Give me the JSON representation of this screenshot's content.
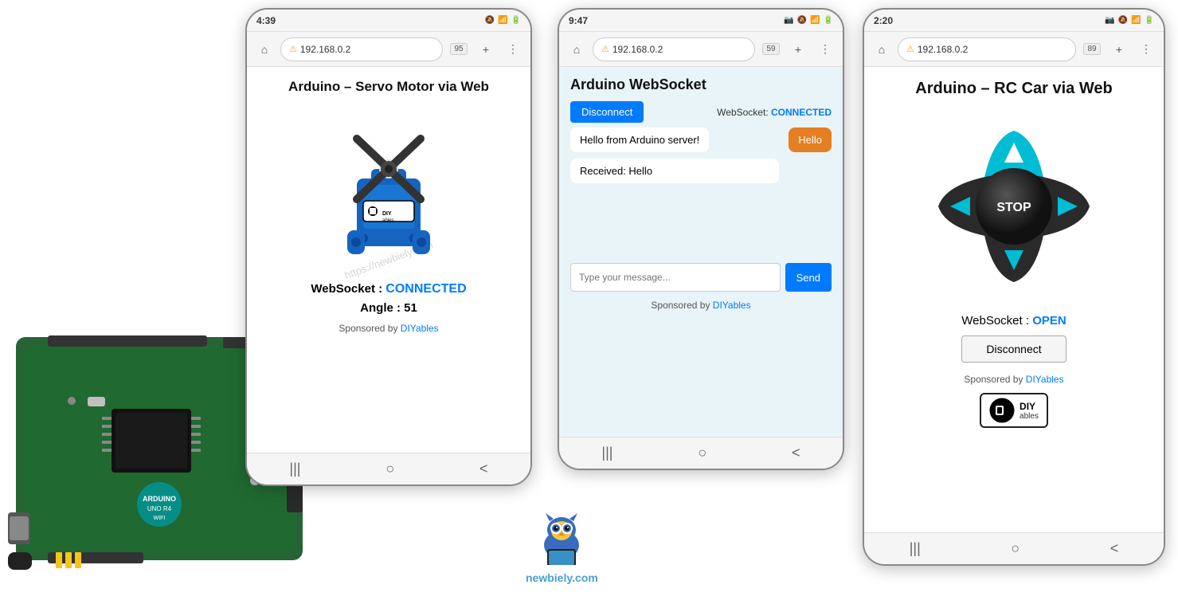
{
  "page": {
    "background": "#ffffff"
  },
  "phone1": {
    "time": "4:39",
    "address": "192.168.0.2",
    "tab_count": "95",
    "title": "Arduino – Servo Motor via Web",
    "websocket_label": "WebSocket : ",
    "websocket_status": "CONNECTED",
    "angle_label": "Angle : ",
    "angle_value": "51",
    "sponsored_text": "Sponsored by ",
    "sponsored_link": "DIYables",
    "watermark": "https://newbiely.com"
  },
  "phone2": {
    "time": "9:47",
    "address": "192.168.0.2",
    "tab_count": "59",
    "page_title": "Arduino WebSocket",
    "disconnect_btn": "Disconnect",
    "ws_label": "WebSocket: ",
    "ws_status": "CONNECTED",
    "message1": "Hello from Arduino server!",
    "message2": "Hello",
    "received_msg": "Received: Hello",
    "input_placeholder": "Type your message...",
    "send_btn": "Send",
    "sponsored_text": "Sponsored by ",
    "sponsored_link": "DIYables"
  },
  "phone3": {
    "time": "2:20",
    "address": "192.168.0.2",
    "tab_count": "89",
    "title": "Arduino – RC Car via Web",
    "stop_label": "STOP",
    "ws_label": "WebSocket : ",
    "ws_status": "OPEN",
    "disconnect_btn": "Disconnect",
    "sponsored_text": "Sponsored by ",
    "sponsored_link": "DIYables"
  },
  "newbiely": {
    "url": "newbiely.com"
  },
  "icons": {
    "home": "⌂",
    "menu": "⋮",
    "plus": "+",
    "back": "<",
    "bars": "|||",
    "circle": "○"
  }
}
